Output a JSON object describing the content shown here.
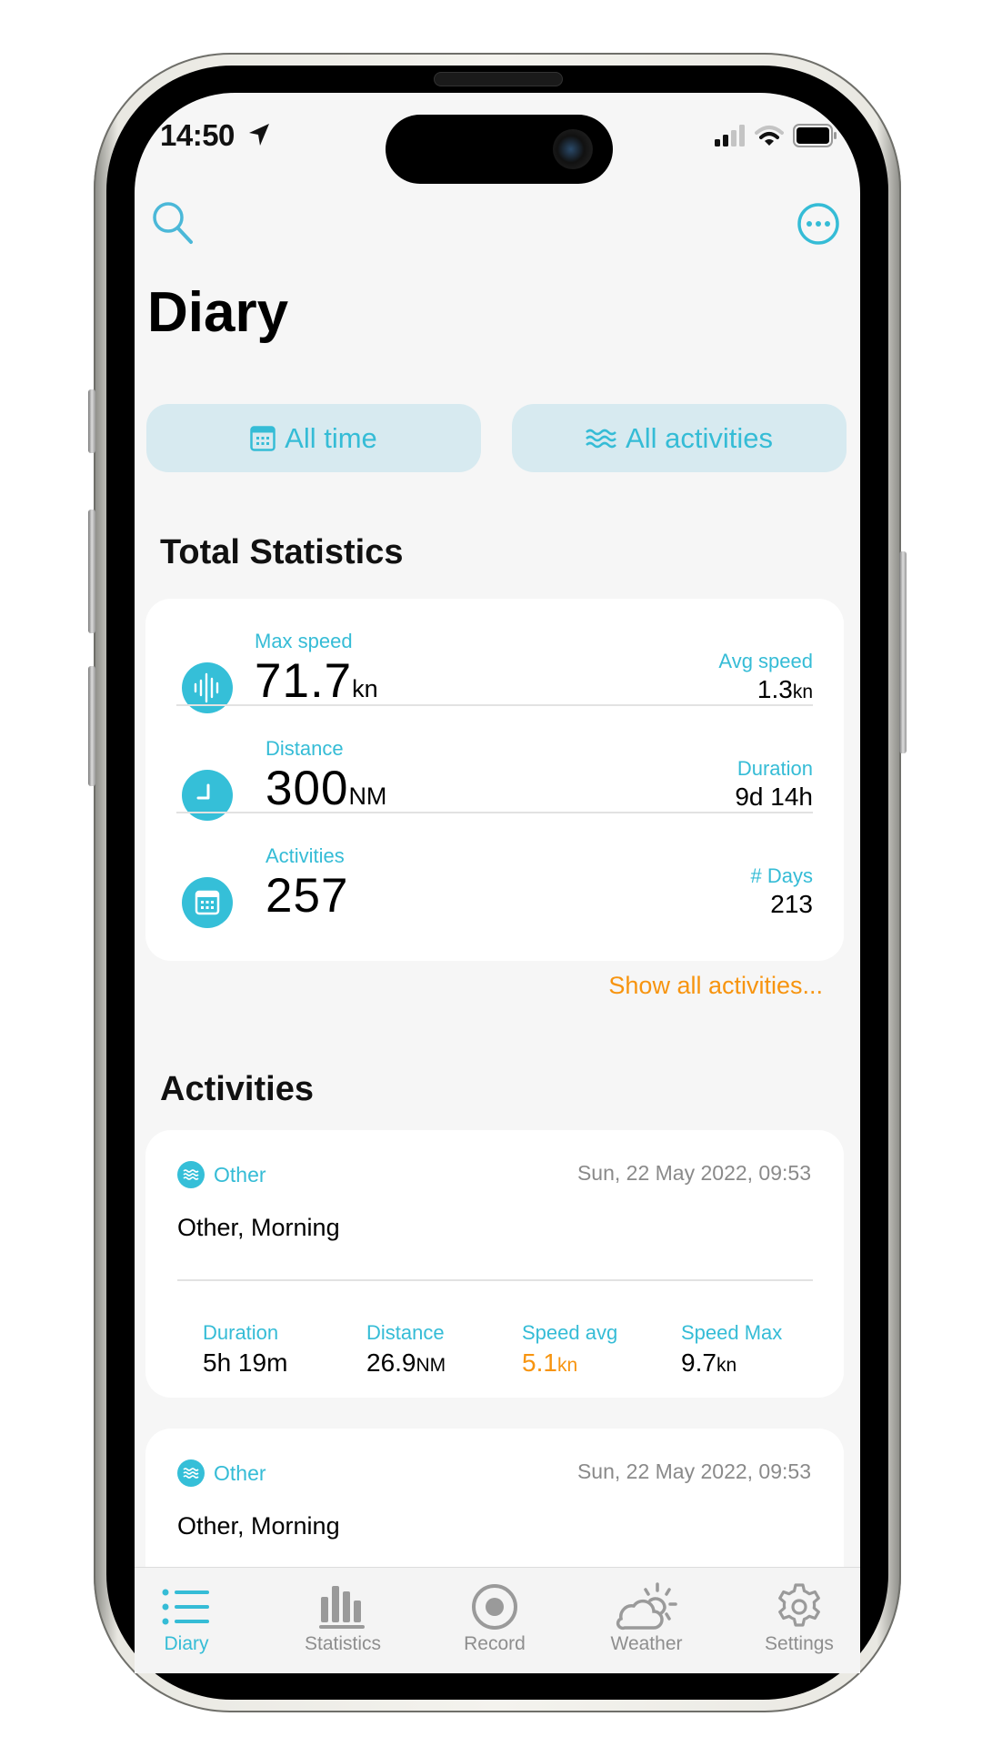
{
  "status_bar": {
    "time": "14:50"
  },
  "colors": {
    "accent": "#35bcd6",
    "orange": "#f7940f",
    "filter_bg": "#d7eaf0",
    "inactive": "#8e8e8e"
  },
  "header": {
    "title": "Diary",
    "search_icon": "search-icon",
    "more_icon": "ellipsis-circle-icon"
  },
  "filters": [
    {
      "label": "All time",
      "icon": "calendar-icon"
    },
    {
      "label": "All activities",
      "icon": "waves-icon"
    }
  ],
  "total_statistics": {
    "title": "Total Statistics",
    "rows": [
      {
        "icon": "waveform-icon",
        "label": "Max speed",
        "value": "71.7",
        "unit": "kn",
        "right_label": "Avg speed",
        "right_value": "1.3",
        "right_unit": "kn"
      },
      {
        "icon": "clock-icon",
        "label": "Distance",
        "value": "300",
        "unit": "NM",
        "right_label": "Duration",
        "right_value": "9d 14h",
        "right_unit": ""
      },
      {
        "icon": "calendar-icon",
        "label": "Activities",
        "value": "257",
        "unit": "",
        "right_label": "# Days",
        "right_value": "213",
        "right_unit": ""
      }
    ],
    "show_all_link": "Show all activities..."
  },
  "activities": {
    "title": "Activities",
    "items": [
      {
        "type": "Other",
        "date": "Sun, 22 May 2022, 09:53",
        "title": "Other, Morning",
        "metrics": [
          {
            "label": "Duration",
            "value": "5h 19m",
            "unit": ""
          },
          {
            "label": "Distance",
            "value": "26.9",
            "unit": "NM"
          },
          {
            "label": "Speed avg",
            "value": "5.1",
            "unit": "kn"
          },
          {
            "label": "Speed Max",
            "value": "9.7",
            "unit": "kn"
          }
        ]
      },
      {
        "type": "Other",
        "date": "Sun, 22 May 2022, 09:53",
        "title": "Other, Morning"
      }
    ]
  },
  "tabbar": {
    "tabs": [
      {
        "label": "Diary",
        "icon": "list-icon",
        "active": true
      },
      {
        "label": "Statistics",
        "icon": "bar-chart-icon",
        "active": false
      },
      {
        "label": "Record",
        "icon": "record-icon",
        "active": false
      },
      {
        "label": "Weather",
        "icon": "cloud-sun-icon",
        "active": false
      },
      {
        "label": "Settings",
        "icon": "gear-icon",
        "active": false
      }
    ]
  }
}
